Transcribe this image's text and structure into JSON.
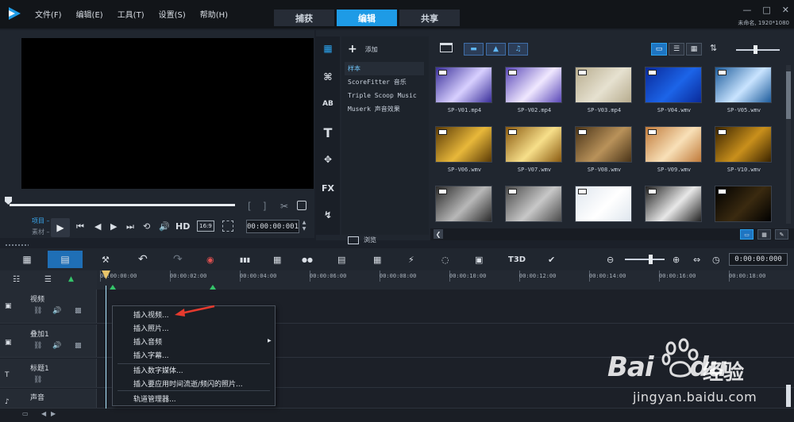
{
  "menu": [
    "文件(F)",
    "编辑(E)",
    "工具(T)",
    "设置(S)",
    "帮助(H)"
  ],
  "tabs": [
    {
      "label": "捕获",
      "active": false
    },
    {
      "label": "编辑",
      "active": true
    },
    {
      "label": "共享",
      "active": false
    }
  ],
  "window": {
    "minimize": "—",
    "maximize": "□",
    "close": "✕",
    "project_info": "未命名, 1920*1080"
  },
  "player": {
    "mode_project": "项目 –",
    "mode_clip": "素材 –",
    "hd_label": "HD",
    "ratio_label": "16:9",
    "timecode": "00:00:00:001",
    "icons": {
      "play": "▶",
      "start": "⏮",
      "prev": "◀",
      "next": "▶",
      "end": "⏭",
      "repeat": "⟲",
      "volume": "🔊"
    }
  },
  "library": {
    "add_label": "添加",
    "browse_label": "浏览",
    "side_icons": [
      "media-icon",
      "instant-project-icon",
      "title-template-icon",
      "text-icon",
      "transition-icon",
      "fx-icon",
      "path-icon"
    ],
    "side_labels": [
      "▦",
      "⌘",
      "AB",
      "T",
      "✥",
      "FX",
      "↯"
    ],
    "items": [
      {
        "label": "样本",
        "selected": true
      },
      {
        "label": "ScoreFitter 音乐",
        "selected": false
      },
      {
        "label": "Triple Scoop Music",
        "selected": false
      },
      {
        "label": "Muserk 声音效果",
        "selected": false
      }
    ],
    "thumbs": [
      {
        "caption": "SP-V01.mp4",
        "c1": "#3a2f9a",
        "c2": "#d8d0ff"
      },
      {
        "caption": "SP-V02.mp4",
        "c1": "#5a48b8",
        "c2": "#f0e8ff"
      },
      {
        "caption": "SP-V03.mp4",
        "c1": "#b7ac8e",
        "c2": "#e6e1d0"
      },
      {
        "caption": "SP-V04.wmv",
        "c1": "#0a2a9a",
        "c2": "#1c64e8"
      },
      {
        "caption": "SP-V05.wmv",
        "c1": "#1d5c9c",
        "c2": "#c9e4ff"
      },
      {
        "caption": "SP-V06.wmv",
        "c1": "#5a3a06",
        "c2": "#e8b83a"
      },
      {
        "caption": "SP-V07.wmv",
        "c1": "#8a5a10",
        "c2": "#f7df8a"
      },
      {
        "caption": "SP-V08.wmv",
        "c1": "#4a3418",
        "c2": "#b9925a"
      },
      {
        "caption": "SP-V09.wmv",
        "c1": "#c07a3a",
        "c2": "#f8e0b8"
      },
      {
        "caption": "SP-V10.wmv",
        "c1": "#3a2400",
        "c2": "#c9901c"
      },
      {
        "caption": "",
        "c1": "#2a2a2a",
        "c2": "#b8b8b8"
      },
      {
        "caption": "",
        "c1": "#4a4a4a",
        "c2": "#c8c8c8"
      },
      {
        "caption": "",
        "c1": "#dfe6ee",
        "c2": "#ffffff"
      },
      {
        "caption": "",
        "c1": "#222",
        "c2": "#e8e8e8"
      },
      {
        "caption": "",
        "c1": "#000",
        "c2": "#3a2a10"
      }
    ]
  },
  "timeline": {
    "timecode": "0:00:00:000",
    "ruler": [
      "00:00:00:00",
      "00:00:02:00",
      "00:00:04:00",
      "00:00:06:00",
      "00:00:08:00",
      "00:00:10:00",
      "00:00:12:00",
      "00:00:14:00",
      "00:00:16:00",
      "00:00:18:00"
    ],
    "tracks": [
      {
        "name": "视频",
        "icon": "▣"
      },
      {
        "name": "叠加1",
        "icon": "▣"
      },
      {
        "name": "标题1",
        "icon": "T"
      },
      {
        "name": "声音",
        "icon": "♪"
      }
    ],
    "tools": [
      "⚒",
      "↶",
      "↷",
      "◉",
      "▮▮▮",
      "▦",
      "●●",
      "▤",
      "▦",
      "⚡",
      "◌",
      "▣",
      "T3D",
      "✔"
    ]
  },
  "context_menu": {
    "items": [
      "插入视频...",
      "插入照片...",
      "插入音频",
      "插入字幕...",
      "插入数字媒体...",
      "插入要应用时间流逝/频闪的照片...",
      "轨道管理器..."
    ],
    "submenu_arrow": "▶"
  },
  "watermark": {
    "brand": "Bai",
    "brand2": "du",
    "cn": "经验",
    "url": "jingyan.baidu.com"
  }
}
